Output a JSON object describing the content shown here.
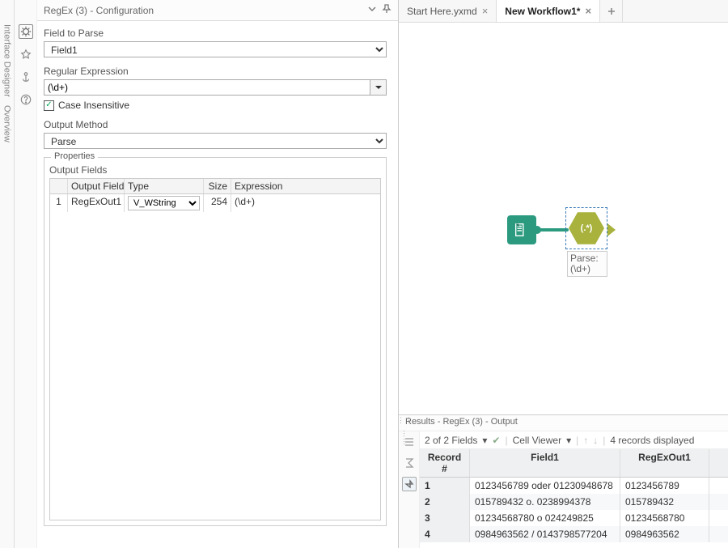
{
  "left_sidebar": {
    "item1": "Interface Designer",
    "item2": "Overview"
  },
  "config": {
    "title": "RegEx (3) - Configuration",
    "field_to_parse_label": "Field to Parse",
    "field_to_parse_value": "Field1",
    "regex_label": "Regular Expression",
    "regex_value": "(\\d+)",
    "case_insensitive_label": "Case Insensitive",
    "output_method_label": "Output Method",
    "output_method_value": "Parse",
    "properties_label": "Properties",
    "output_fields_label": "Output Fields",
    "grid": {
      "headers": {
        "output_field": "Output Field",
        "type": "Type",
        "size": "Size",
        "expression": "Expression"
      },
      "rows": [
        {
          "idx": "1",
          "output_field": "RegExOut1",
          "type": "V_WString",
          "size": "254",
          "expression": "(\\d+)"
        }
      ]
    }
  },
  "tabs": [
    {
      "label": "Start Here.yxmd",
      "active": false
    },
    {
      "label": "New Workflow1*",
      "active": true
    }
  ],
  "canvas": {
    "node_label_l1": "Parse:",
    "node_label_l2": "(\\d+)",
    "regex_txt": "(.*)"
  },
  "results": {
    "title": "Results - RegEx (3) - Output",
    "toolbar": {
      "fields": "2 of 2 Fields",
      "cell_viewer": "Cell Viewer",
      "records": "4 records displayed"
    },
    "columns": {
      "rec": "Record #",
      "f1": "Field1",
      "f2": "RegExOut1"
    },
    "rows": [
      {
        "rec": "1",
        "f1": "0123456789 oder 01230948678",
        "f2": "0123456789"
      },
      {
        "rec": "2",
        "f1": "015789432 o. 0238994378",
        "f2": "015789432"
      },
      {
        "rec": "3",
        "f1": "01234568780 o 024249825",
        "f2": "01234568780"
      },
      {
        "rec": "4",
        "f1": "0984963562 / 0143798577204",
        "f2": "0984963562"
      }
    ]
  }
}
